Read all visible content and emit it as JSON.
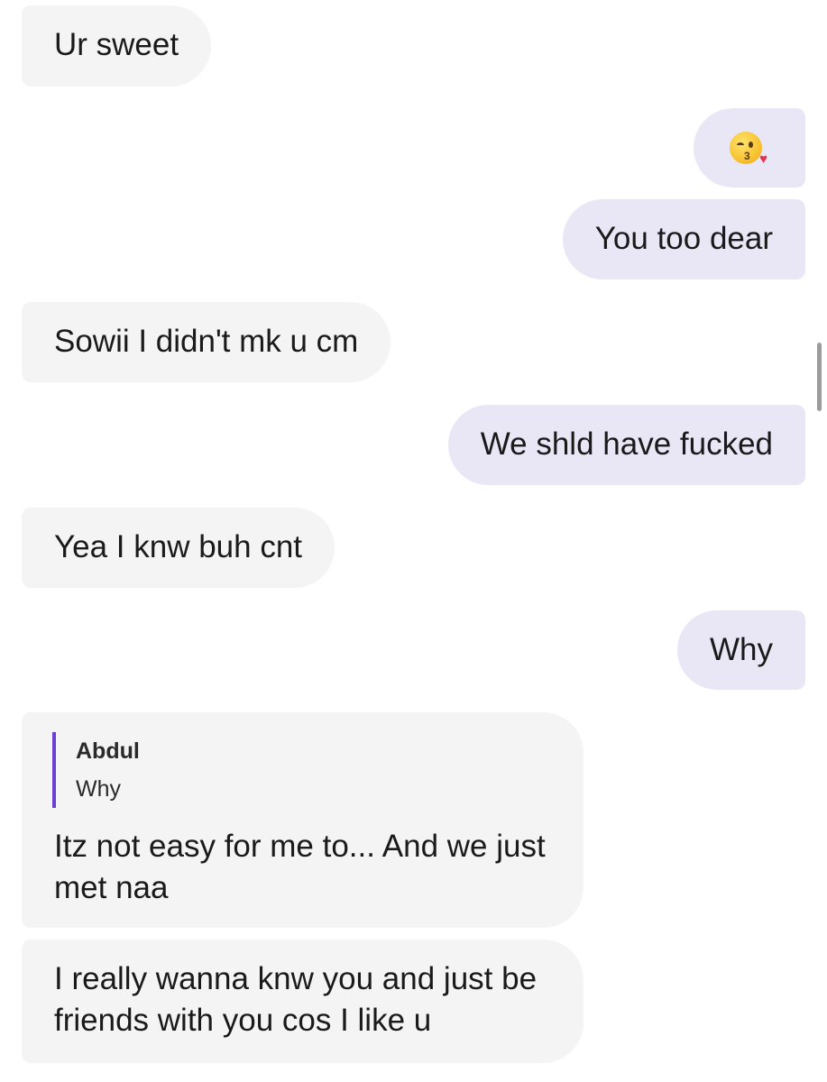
{
  "messages": [
    {
      "side": "incoming",
      "text": "Ur sweet"
    },
    {
      "side": "outgoing",
      "emoji": "kissing-face-with-heart"
    },
    {
      "side": "outgoing",
      "text": "You too dear"
    },
    {
      "side": "incoming",
      "text": "Sowii I didn't mk u cm"
    },
    {
      "side": "outgoing",
      "text": "We shld have fucked"
    },
    {
      "side": "incoming",
      "text": "Yea I knw buh cnt"
    },
    {
      "side": "outgoing",
      "text": "Why"
    },
    {
      "side": "incoming",
      "reply": {
        "author": "Abdul",
        "text": "Why"
      },
      "text": "Itz not easy for me to... And we just met naa"
    },
    {
      "side": "incoming",
      "text": "I really wanna knw you and just be friends with you cos I like u"
    }
  ],
  "colors": {
    "incoming_bubble": "#f4f4f5",
    "outgoing_bubble": "#e9e7f6",
    "reply_accent": "#6b3fd4"
  }
}
